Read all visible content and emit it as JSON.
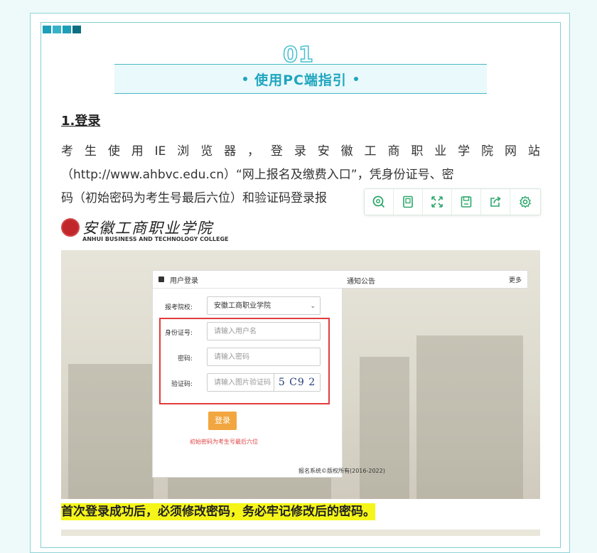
{
  "section": {
    "number": "01",
    "title": "使用PC端指引",
    "accent_color": "#1fa5bf",
    "squares_colors": [
      "#1c9fb8",
      "#36b3c9",
      "#1c9fb8",
      "#0f6f82"
    ]
  },
  "step": {
    "heading": "1.登录",
    "paragraph_lines": [
      "考生使用IE浏览器，登录安徽工商职业学院网站",
      "（http://www.ahbvc.edu.cn）“网上报名及缴费入口”，凭身份证号、密",
      "码（初始密码为考生号最后六位）和验证码登录报"
    ]
  },
  "toolbar": {
    "icons": [
      "search-zoom-icon",
      "page-icon",
      "fullscreen-icon",
      "save-icon",
      "share-icon",
      "settings-icon"
    ],
    "color": "#2aa86a"
  },
  "embedded_screenshot": {
    "school_name_cn": "安徽工商职业学院",
    "school_name_en": "ANHUI BUSINESS AND TECHNOLOGY COLLEGE",
    "login_panel": {
      "header": "用户登录",
      "school_label": "报考院校:",
      "school_value": "安徽工商职业学院",
      "id_label": "身份证号:",
      "id_placeholder": "请输入用户名",
      "password_label": "密码:",
      "password_placeholder": "请输入密码",
      "captcha_label": "验证码:",
      "captcha_placeholder": "请输入图片验证码",
      "captcha_text": "5 C9 2",
      "login_button": "登录",
      "hint": "初始密码为考生号最后六位"
    },
    "notice": {
      "title": "通知公告",
      "more": "更多"
    },
    "copyright": "报名系统©版权所有(2016-2022)"
  },
  "warning": "首次登录成功后，必须修改密码，务必牢记修改后的密码。"
}
